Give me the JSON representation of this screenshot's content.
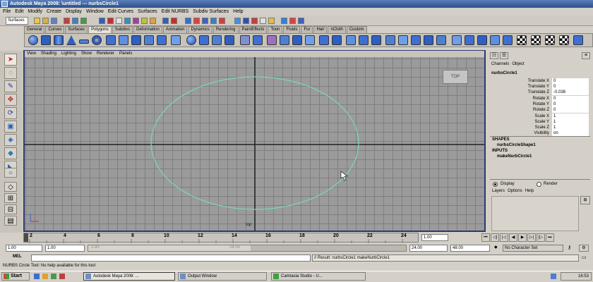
{
  "window": {
    "title": "Autodesk Maya 2008:  \\untitled   ---   nurbsCircle1"
  },
  "menu": [
    "File",
    "Edit",
    "Modify",
    "Create",
    "Display",
    "Window",
    "Edit Curves",
    "Surfaces",
    "Edit NURBS",
    "Subdiv Surfaces",
    "Help"
  ],
  "status": {
    "mode": "Surfaces"
  },
  "shelf_tabs": [
    "General",
    "Curves",
    "Surfaces",
    "Polygons",
    "Subdivs",
    "Deformation",
    "Animation",
    "Dynamics",
    "Rendering",
    "PaintEffects",
    "Toon",
    "Fluids",
    "Fur",
    "Hair",
    "nCloth",
    "Custom"
  ],
  "shelf_active": "Polygons",
  "panel_menu": [
    "View",
    "Shading",
    "Lighting",
    "Show",
    "Renderer",
    "Panels"
  ],
  "viewport": {
    "camera_label": "top",
    "view_cube_label": "TOP"
  },
  "channel_box": {
    "header": [
      "Channels",
      "Object"
    ],
    "object_name": "nurbsCircle1",
    "attributes": [
      {
        "label": "Translate X",
        "value": "0"
      },
      {
        "label": "Translate Y",
        "value": "0"
      },
      {
        "label": "Translate Z",
        "value": "-0.038"
      },
      {
        "label": "Rotate X",
        "value": "0"
      },
      {
        "label": "Rotate Y",
        "value": "0"
      },
      {
        "label": "Rotate Z",
        "value": "0"
      },
      {
        "label": "Scale X",
        "value": "1"
      },
      {
        "label": "Scale Y",
        "value": "1"
      },
      {
        "label": "Scale Z",
        "value": "1"
      },
      {
        "label": "Visibility",
        "value": "on"
      }
    ],
    "shapes_heading": "SHAPES",
    "shape_name": "nurbsCircleShape1",
    "inputs_heading": "INPUTS",
    "input_name": "makeNurbCircle1"
  },
  "layers": {
    "display_label": "Display",
    "render_label": "Render",
    "menu": [
      "Layers",
      "Options",
      "Help"
    ]
  },
  "timeline": {
    "ticks": [
      "2",
      "4",
      "6",
      "8",
      "10",
      "12",
      "14",
      "16",
      "18",
      "20",
      "22",
      "24"
    ],
    "current_frame": "1.00"
  },
  "range": {
    "start": "1.00",
    "playback_start": "1.00",
    "range_left": "1.00",
    "range_right": "24.00",
    "playback_end": "24.00",
    "end": "48.00",
    "character_set": "No Character Set"
  },
  "command": {
    "label": "MEL",
    "result": "// Result: nurbsCircle1 makeNurbCircle1"
  },
  "help_line": "NURBS Circle Tool: No help available for this tool",
  "taskbar": {
    "start": "Start",
    "tasks": [
      "Autodesk Maya 2008: ...",
      "Output Window",
      "Camtasia Studio - U..."
    ],
    "clock": "16:53"
  }
}
